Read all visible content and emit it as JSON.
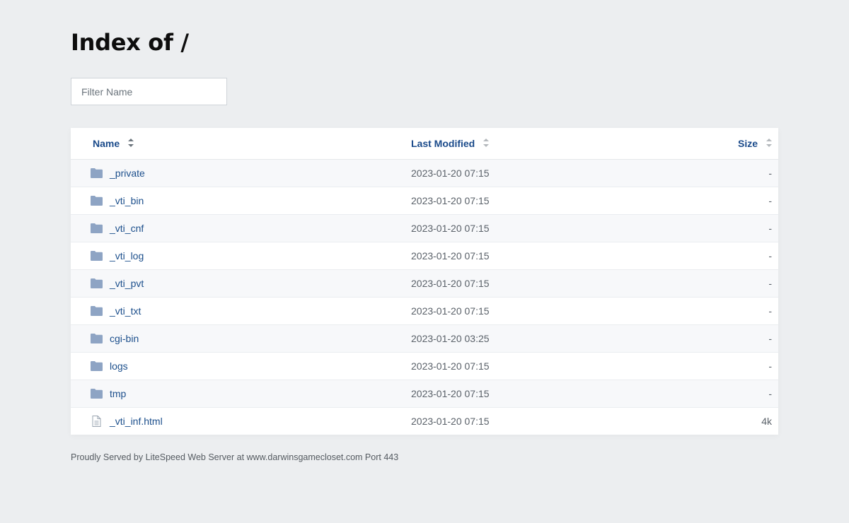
{
  "page": {
    "title": "Index of /"
  },
  "filter": {
    "placeholder": "Filter Name",
    "value": ""
  },
  "table": {
    "headers": {
      "name": "Name",
      "modified": "Last Modified",
      "size": "Size"
    },
    "rows": [
      {
        "name": "_private",
        "modified": "2023-01-20 07:15",
        "size": "-",
        "type": "folder-icon"
      },
      {
        "name": "_vti_bin",
        "modified": "2023-01-20 07:15",
        "size": "-",
        "type": "folder-icon"
      },
      {
        "name": "_vti_cnf",
        "modified": "2023-01-20 07:15",
        "size": "-",
        "type": "folder-icon"
      },
      {
        "name": "_vti_log",
        "modified": "2023-01-20 07:15",
        "size": "-",
        "type": "folder-icon"
      },
      {
        "name": "_vti_pvt",
        "modified": "2023-01-20 07:15",
        "size": "-",
        "type": "folder-icon"
      },
      {
        "name": "_vti_txt",
        "modified": "2023-01-20 07:15",
        "size": "-",
        "type": "folder-icon"
      },
      {
        "name": "cgi-bin",
        "modified": "2023-01-20 03:25",
        "size": "-",
        "type": "folder-icon"
      },
      {
        "name": "logs",
        "modified": "2023-01-20 07:15",
        "size": "-",
        "type": "folder-icon"
      },
      {
        "name": "tmp",
        "modified": "2023-01-20 07:15",
        "size": "-",
        "type": "folder-icon"
      },
      {
        "name": "_vti_inf.html",
        "modified": "2023-01-20 07:15",
        "size": "4k",
        "type": "file-icon"
      }
    ]
  },
  "footer": {
    "text": "Proudly Served by LiteSpeed Web Server at www.darwinsgamecloset.com Port 443"
  },
  "colors": {
    "background": "#eceef0",
    "link": "#1c4f8c",
    "header_link": "#1a4a8a",
    "folder_icon": "#8ea4c4"
  }
}
